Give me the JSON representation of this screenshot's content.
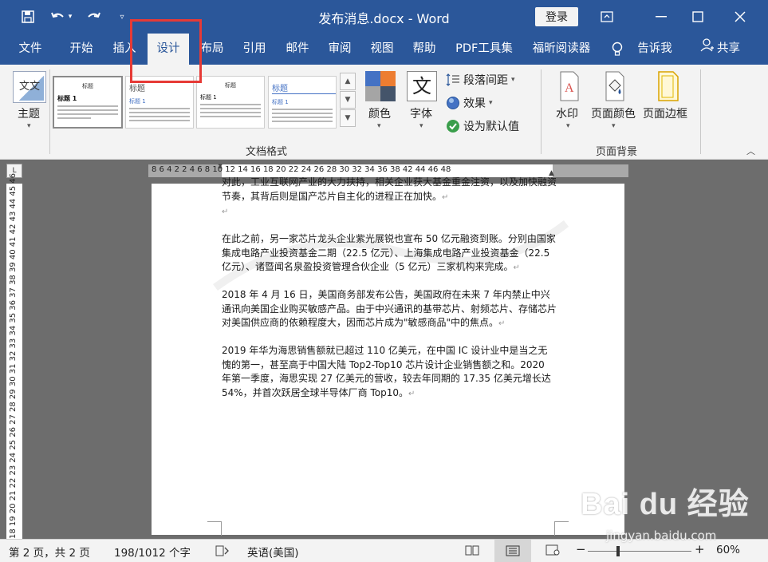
{
  "window": {
    "doc_title": "发布消息.docx  -  Word",
    "login_label": "登录"
  },
  "tabs": [
    {
      "label": "文件"
    },
    {
      "label": "开始"
    },
    {
      "label": "插入"
    },
    {
      "label": "设计"
    },
    {
      "label": "布局"
    },
    {
      "label": "引用"
    },
    {
      "label": "邮件"
    },
    {
      "label": "审阅"
    },
    {
      "label": "视图"
    },
    {
      "label": "帮助"
    },
    {
      "label": "PDF工具集"
    },
    {
      "label": "福昕阅读器"
    },
    {
      "label": "告诉我"
    }
  ],
  "active_tab": "设计",
  "share_label": "共享",
  "ribbon": {
    "theme_label": "主题",
    "theme_icon_text": "文文",
    "style_thumbs": [
      {
        "title": "标题",
        "heading": "标题 1"
      },
      {
        "title": "标题",
        "heading": "标题 1"
      },
      {
        "title": "标题",
        "heading": "标题 1"
      },
      {
        "title": "标题",
        "heading": "标题 1"
      }
    ],
    "colors_label": "颜色",
    "fonts_label": "字体",
    "fonts_icon_text": "文",
    "paragraph_spacing_label": "段落间距",
    "effects_label": "效果",
    "set_default_label": "设为默认值",
    "group_document_format": "文档格式",
    "watermark_label": "水印",
    "page_color_label": "页面颜色",
    "page_border_label": "页面边框",
    "group_page_background": "页面背景",
    "swatch_colors": [
      "#4472c4",
      "#ed7d31",
      "#a5a5a5",
      "#44546a"
    ]
  },
  "ruler": {
    "corner": "L",
    "horizontal_ticks": "8  6  4  2     2  4  6  8 10 12 14 16 18 20 22 24 26 28 30 32 34 36 38     42 44 46 48",
    "vertical_ticks": "18 19 20 21 22 23 24 25 26 27 28 29 30 31 32 33 34 35 36 37 38 39 40 41 42 43 44 45 46"
  },
  "document": {
    "paragraphs": [
      "对此，工业互联网产业的大力扶持，相关企业获大基金重金注资，以及加快融资节奏，其背后则是国产芯片自主化的进程正在加快。",
      "在此之前，另一家芯片龙头企业紫光展锐也宣布 50 亿元融资到账。分别由国家集成电路产业投资基金二期（22.5 亿元）、上海集成电路产业投资基金（22.5 亿元）、诸暨闻名泉盈投资管理合伙企业（5 亿元）三家机构来完成。",
      "2018 年 4 月 16 日，美国商务部发布公告，美国政府在未来 7 年内禁止中兴通讯向美国企业购买敏感产品。由于中兴通讯的基带芯片、射频芯片、存储芯片对美国供应商的依赖程度大，因而芯片成为\"敏感商品\"中的焦点。",
      "2019 年华为海思销售额就已超过 110 亿美元，在中国 IC 设计业中是当之无愧的第一，甚至高于中国大陆 Top2-Top10 芯片设计企业销售额之和。2020 年第一季度，海思实现 27 亿美元的营收，较去年同期的 17.35 亿美元增长达 54%，并首次跃居全球半导体厂商 Top10。"
    ],
    "paragraph_mark": "↵"
  },
  "statusbar": {
    "page_info": "第 2 页，共 2 页",
    "word_count": "198/1012 个字",
    "language": "英语(美国)",
    "zoom": "60%",
    "zoom_level": 0.6
  },
  "watermark": {
    "brand": "Bai du 经验",
    "url": "jingyan.baidu.com"
  }
}
